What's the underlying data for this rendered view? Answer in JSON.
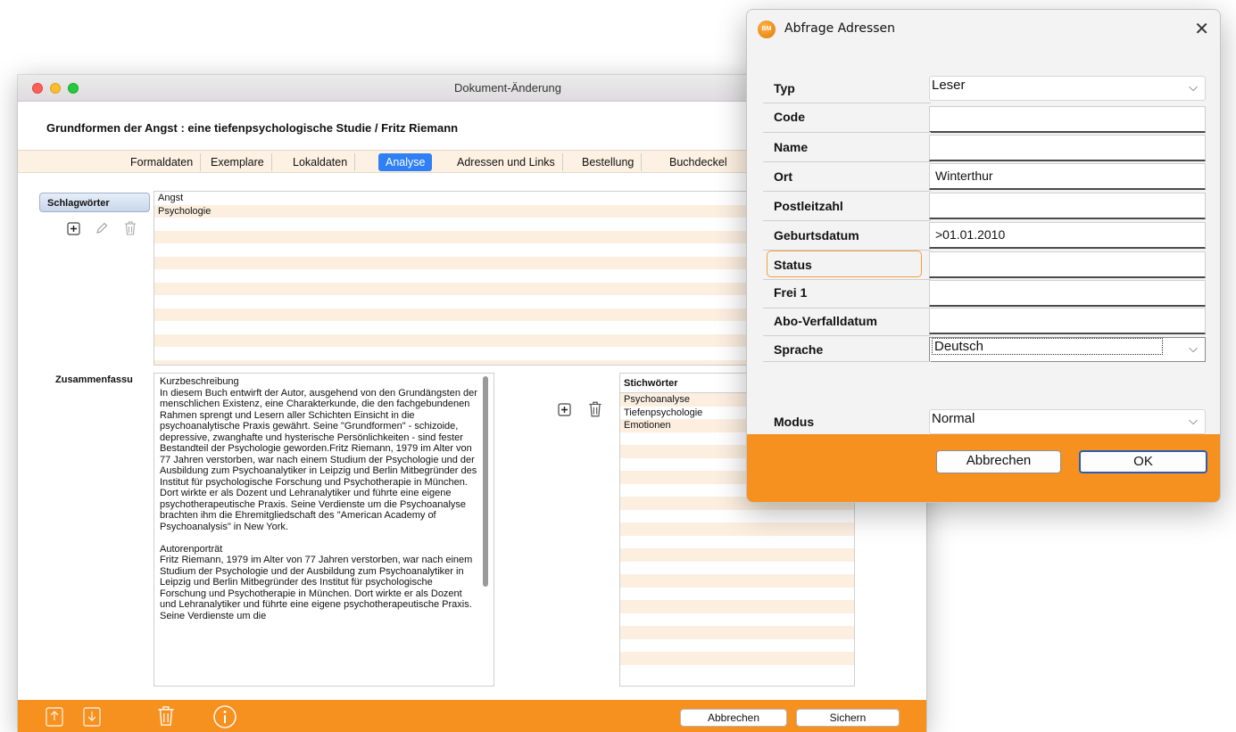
{
  "main_window": {
    "title": "Dokument-Änderung",
    "heading": "Grundformen der Angst : eine tiefenpsychologische Studie / Fritz Riemann",
    "tabs": [
      {
        "label": "Formaldaten",
        "active": false
      },
      {
        "label": "Exemplare",
        "active": false
      },
      {
        "label": "Lokaldaten",
        "active": false
      },
      {
        "label": "Analyse",
        "active": true
      },
      {
        "label": "Adressen und Links",
        "active": false
      },
      {
        "label": "Bestellung",
        "active": false
      },
      {
        "label": "Buchdeckel",
        "active": false
      }
    ],
    "schlagwoerter": {
      "label": "Schlagwörter",
      "items": [
        "Angst",
        "Psychologie"
      ]
    },
    "zusammenfassung": {
      "label": "Zusammenfassu",
      "text": "Kurzbeschreibung\nIn diesem Buch entwirft der Autor, ausgehend von den Grundängsten der menschlichen Existenz, eine Charakterkunde, die den fachgebundenen Rahmen sprengt und Lesern aller Schichten Einsicht in die psychoanalytische Praxis gewährt. Seine \"Grundformen\" - schizoide, depressive, zwanghafte und hysterische Persönlichkeiten - sind fester Bestandteil der Psychologie geworden.Fritz Riemann, 1979 im Alter von 77 Jahren verstorben, war nach einem Studium der Psychologie und der Ausbildung zum Psychoanalytiker in Leipzig und Berlin Mitbegründer des Institut für psychologische Forschung und Psychotherapie in München. Dort wirkte er als Dozent und Lehranalytiker und führte eine eigene psychotherapeutische Praxis. Seine Verdienste um die Psychoanalyse brachten ihm die Ehremitgliedschaft des \"American Academy of Psychoanalysis\" in New York.\n\nAutorenporträt\nFritz Riemann, 1979 im Alter von 77 Jahren verstorben, war nach einem Studium der Psychologie und der Ausbildung zum Psychoanalytiker in Leipzig und Berlin Mitbegründer des Institut für psychologische Forschung und Psychotherapie in München. Dort wirkte er als Dozent und Lehranalytiker und führte eine eigene psychotherapeutische Praxis. Seine Verdienste um die"
    },
    "stichwoerter": {
      "header": "Stichwörter",
      "items": [
        "Psychoanalyse",
        "Tiefenpsychologie",
        "Emotionen"
      ]
    },
    "footer": {
      "cancel_label": "Abbrechen",
      "save_label": "Sichern"
    },
    "icons": [
      "add-icon",
      "edit-icon",
      "trash-icon",
      "upload-icon",
      "download-icon",
      "info-icon"
    ]
  },
  "dialog": {
    "title": "Abfrage Adressen",
    "fields": {
      "typ": {
        "label": "Typ",
        "value": "Leser"
      },
      "code": {
        "label": "Code",
        "value": ""
      },
      "name": {
        "label": "Name",
        "value": ""
      },
      "ort": {
        "label": "Ort",
        "value": "Winterthur"
      },
      "postleitzahl": {
        "label": "Postleitzahl",
        "value": ""
      },
      "geburtsdatum": {
        "label": "Geburtsdatum",
        "value": ">01.01.2010"
      },
      "status": {
        "label": "Status",
        "value": ""
      },
      "frei1": {
        "label": "Frei 1",
        "value": ""
      },
      "abo": {
        "label": "Abo-Verfalldatum",
        "value": ""
      },
      "sprache": {
        "label": "Sprache",
        "value": "Deutsch"
      },
      "modus": {
        "label": "Modus",
        "value": "Normal"
      }
    },
    "cancel_label": "Abbrechen",
    "ok_label": "OK"
  },
  "colors": {
    "accent_orange": "#f6901e",
    "tab_active_blue": "#2f7ff5",
    "row_alt": "#fcefe0"
  }
}
